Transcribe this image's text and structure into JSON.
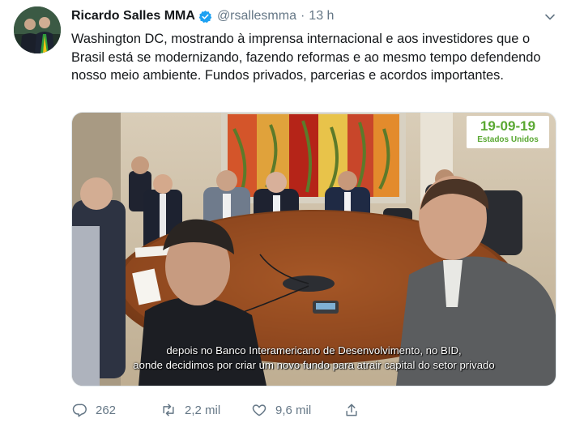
{
  "tweet": {
    "author_name": "Ricardo Salles MMA",
    "handle": "@rsallesmma",
    "separator": "·",
    "time": "13 h",
    "text": "Washington DC, mostrando à imprensa internacional e aos investidores que o Brasil está se modernizando, fazendo reformas e ao mesmo tempo defendendo nosso meio ambiente. Fundos privados, parcerias e acordos importantes."
  },
  "media": {
    "date_badge": "19-09-19",
    "date_badge_sub": "Estados Unidos",
    "subtitle_line1": "depois no Banco Interamericano de Desenvolvimento, no BID,",
    "subtitle_line2": "aonde decidimos por criar um novo fundo para atrair capital do setor privado",
    "badge_color": "#5aa832"
  },
  "actions": {
    "reply_count": "262",
    "retweet_count": "2,2 mil",
    "like_count": "9,6 mil",
    "reply_icon": "reply-icon",
    "retweet_icon": "retweet-icon",
    "like_icon": "heart-icon",
    "share_icon": "share-icon"
  },
  "colors": {
    "text": "#14171a",
    "muted": "#657786",
    "verified": "#1da1f2"
  }
}
